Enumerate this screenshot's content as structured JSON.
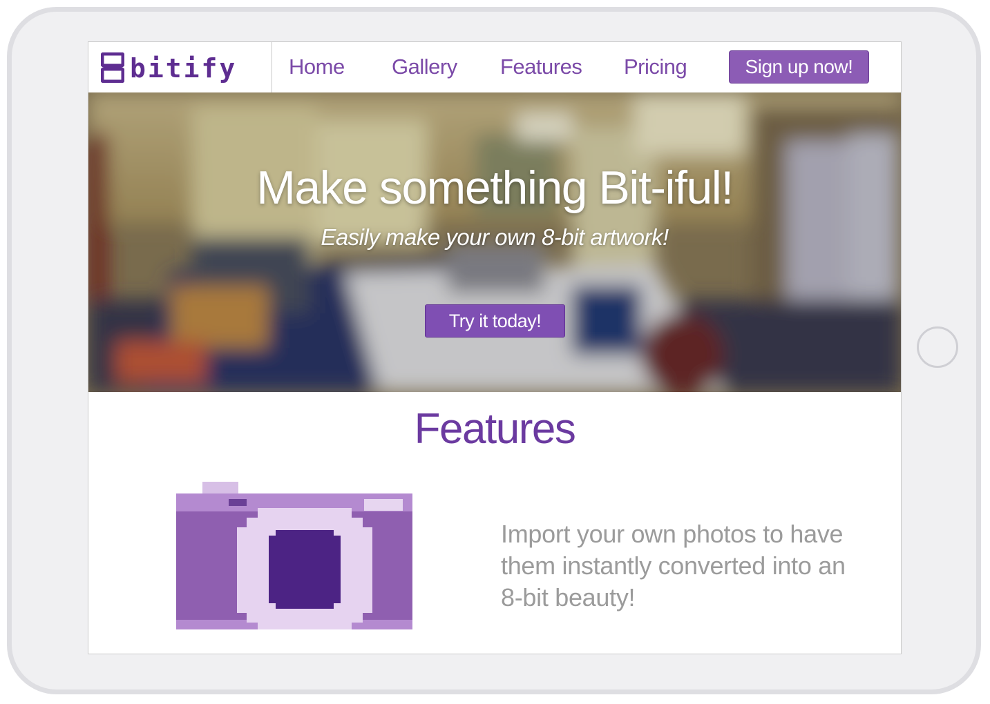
{
  "brand": {
    "logo_digit": "8",
    "logo_text": "bitify",
    "color": "#5e2d91"
  },
  "nav": {
    "items": [
      {
        "label": "Home"
      },
      {
        "label": "Gallery"
      },
      {
        "label": "Features"
      },
      {
        "label": "Pricing"
      }
    ],
    "cta_label": "Sign up now!"
  },
  "hero": {
    "title": "Make something Bit-iful!",
    "subtitle": "Easily make your own 8-bit artwork!",
    "cta_label": "Try it today!"
  },
  "features": {
    "heading": "Features",
    "items": [
      {
        "icon": "camera-icon",
        "text": "Import your own photos to have them instantly converted into an 8-bit beauty!"
      }
    ]
  },
  "colors": {
    "accent": "#8c5cb5",
    "accent_dark": "#6b3aa0",
    "body_text": "#9b9b9b"
  }
}
